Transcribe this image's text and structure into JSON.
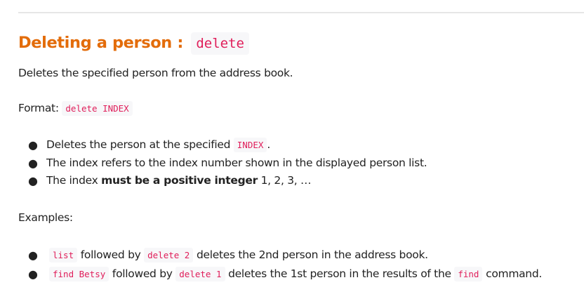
{
  "heading": {
    "text": "Deleting a person :",
    "command": "delete"
  },
  "description": "Deletes the specified person from the address book.",
  "format": {
    "label": "Format:",
    "syntax": "delete INDEX"
  },
  "notes": [
    {
      "before": "Deletes the person at the specified",
      "code": "INDEX",
      "after": "."
    },
    {
      "text": "The index refers to the index number shown in the displayed person list."
    },
    {
      "before": "The index",
      "bold": "must be a positive integer",
      "after": "1, 2, 3, …"
    }
  ],
  "examples_label": "Examples:",
  "examples": [
    {
      "code1": "list",
      "mid": "followed by",
      "code2": "delete 2",
      "after": "deletes the 2nd person in the address book."
    },
    {
      "code1": "find Betsy",
      "mid": "followed by",
      "code2": "delete 1",
      "after": "deletes the 1st person in the results of the",
      "code3": "find",
      "end": "command."
    }
  ],
  "bullet_glyph": "●",
  "colors": {
    "heading": "#e36c0a",
    "code_text": "#e01e5a",
    "code_background": "#f7f7f9",
    "body_text": "#222222"
  }
}
